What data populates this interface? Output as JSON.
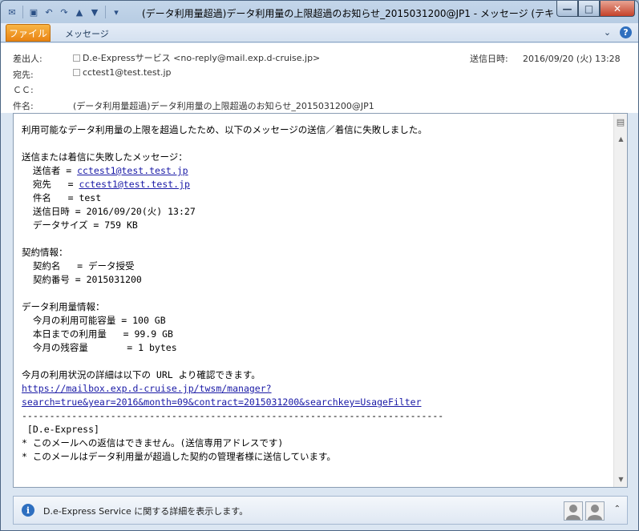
{
  "window": {
    "title": "(データ利用量超過)データ利用量の上限超過のお知らせ_2015031200@JP1 - メッセージ (テキスト...",
    "controls": {
      "minimize": "—",
      "maximize": "□",
      "close": "✕"
    }
  },
  "ribbon": {
    "file_tab": "ファイル",
    "message_tab": "メッセージ"
  },
  "header": {
    "from_label": "差出人:",
    "from_value": "D.e-Expressサービス <no-reply@mail.exp.d-cruise.jp>",
    "to_label": "宛先:",
    "to_value": "cctest1@test.test.jp",
    "cc_label": "ＣＣ:",
    "cc_value": "",
    "subject_label": "件名:",
    "subject_value": "(データ利用量超過)データ利用量の上限超過のお知らせ_2015031200@JP1",
    "sent_label": "送信日時:",
    "sent_value": "2016/09/20 (火) 13:28"
  },
  "body": {
    "line1": "利用可能なデータ利用量の上限を超過したため、以下のメッセージの送信／着信に失敗しました。",
    "failed_heading": "送信または着信に失敗したメッセージ：",
    "sender_label": "  送信者 = ",
    "sender_link": "cctest1@test.test.jp",
    "recipient_label": "  宛先   = ",
    "recipient_link": "cctest1@test.test.jp",
    "subject_line": "  件名   = test",
    "date_line": "  送信日時 = 2016/09/20(火) 13:27",
    "size_line": "  データサイズ = 759 KB",
    "contract_heading": "契約情報：",
    "contract_name": "  契約名   = データ授受",
    "contract_number": "  契約番号 = 2015031200",
    "usage_heading": "データ利用量情報：",
    "usage_capacity": "  今月の利用可能容量 = 100 GB",
    "usage_today": "  本日までの利用量   = 99.9 GB",
    "usage_remaining": "  今月の残容量       = 1 bytes",
    "details_line": "今月の利用状況の詳細は以下の URL より確認できます。",
    "url_line1": "https://mailbox.exp.d-cruise.jp/twsm/manager?",
    "url_line2": "search=true&year=2016&month=09&contract=2015031200&searchkey=UsageFilter",
    "divider": "----------------------------------------------------------------------------",
    "signature": " [D.e-Express]",
    "note1": "* このメールへの返信はできません。(送信専用アドレスです)",
    "note2": "* このメールはデータ利用量が超過した契約の管理者様に送信しています。"
  },
  "people_pane": {
    "text": "D.e-Express Service に関する詳細を表示します。"
  }
}
